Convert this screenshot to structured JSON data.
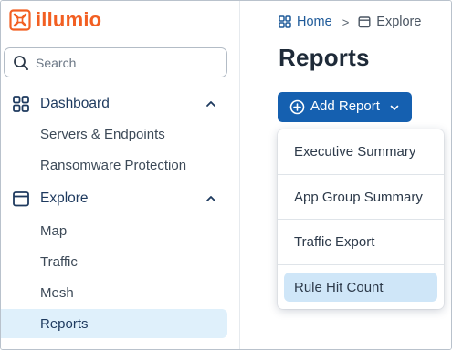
{
  "brand": {
    "name": "illumio",
    "color": "#f25f22"
  },
  "search": {
    "placeholder": "Search",
    "value": ""
  },
  "sidebar": {
    "sections": [
      {
        "label": "Dashboard",
        "icon": "dashboard-grid-icon",
        "expanded": true,
        "items": [
          {
            "label": "Servers & Endpoints",
            "active": false
          },
          {
            "label": "Ransomware Protection",
            "active": false
          }
        ]
      },
      {
        "label": "Explore",
        "icon": "explore-box-icon",
        "expanded": true,
        "items": [
          {
            "label": "Map",
            "active": false
          },
          {
            "label": "Traffic",
            "active": false
          },
          {
            "label": "Mesh",
            "active": false
          },
          {
            "label": "Reports",
            "active": true
          }
        ]
      }
    ]
  },
  "breadcrumb": {
    "home_label": "Home",
    "separator": ">",
    "current_label": "Explore"
  },
  "page": {
    "title": "Reports"
  },
  "add_report": {
    "label": "Add Report",
    "color": "#1560b0",
    "menu": [
      {
        "label": "Executive Summary",
        "highlighted": false
      },
      {
        "label": "App Group Summary",
        "highlighted": false
      },
      {
        "label": "Traffic Export",
        "highlighted": false
      },
      {
        "label": "Rule Hit Count",
        "highlighted": true
      }
    ]
  },
  "colors": {
    "active_nav_bg": "#dff0fb",
    "menu_highlight_bg": "#cfe6f8",
    "nav_text": "#1e3a5f"
  }
}
